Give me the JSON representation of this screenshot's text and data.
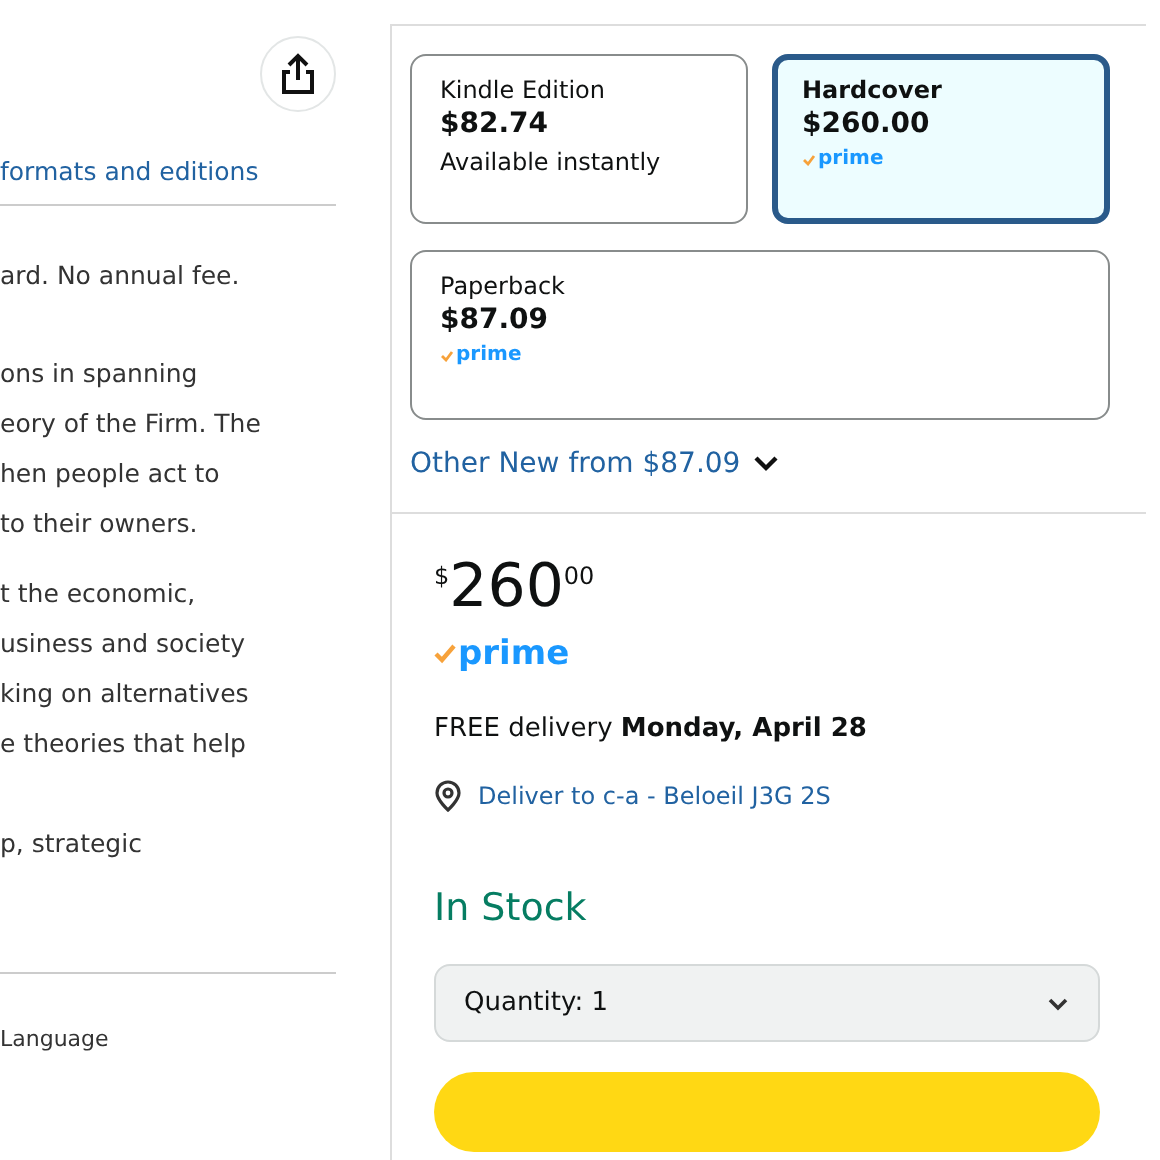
{
  "left": {
    "formats_link": "formats and editions",
    "card_offer": "ard. No annual fee.",
    "description_1": [
      "ons in spanning",
      "eory of the Firm. The",
      "hen people act to",
      "to their owners."
    ],
    "description_2": [
      "t the economic,",
      "usiness and society",
      "king on alternatives",
      "e theories that help"
    ],
    "description_3": "p, strategic",
    "detail_label": "Language"
  },
  "formats": [
    {
      "name": "Kindle Edition",
      "price": "$82.74",
      "note": "Available instantly",
      "selected": false
    },
    {
      "name": "Hardcover",
      "price": "$260.00",
      "prime_label": "prime",
      "selected": true
    },
    {
      "name": "Paperback",
      "price": "$87.09",
      "prime_label": "prime",
      "selected": false
    }
  ],
  "other_new": "Other New from $87.09",
  "buybox": {
    "currency": "$",
    "whole": "260",
    "fraction": "00",
    "prime_label": "prime",
    "delivery": "FREE delivery **Monday, April 28**",
    "deliver_to": "Deliver to c-a - Beloeil J3G 2S",
    "stock": "In Stock",
    "quantity": "Quantity: 1"
  }
}
